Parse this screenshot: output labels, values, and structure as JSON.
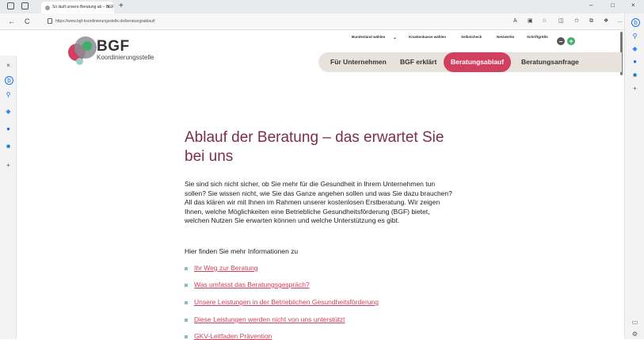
{
  "browser": {
    "tab_title": "So läuft unsere Beratung ab – BGF",
    "tab_close": "×",
    "new_tab": "+",
    "url": "https://www.bgf-koordinierungsstelle.de/beratungsablauf/",
    "minimize": "–",
    "maximize": "□",
    "close": "×",
    "back": "←",
    "reload": "C"
  },
  "site": {
    "brand": "BGF",
    "brand_sub": "Koordinierungsstelle",
    "top_links": [
      "Bundesland wählen",
      "Krankenkasse wählen",
      "Selbstcheck",
      "Netzwerke",
      "Schriftgröße"
    ],
    "dropdown_caret": "⌄",
    "font_minus": "–",
    "font_plus": "+",
    "main_nav": [
      "Für Unternehmen",
      "BGF erklärt",
      "Beratungsablauf",
      "Beratungsanfrage"
    ],
    "active_nav": "Beratungsablauf"
  },
  "content": {
    "heading": "Ablauf der Beratung – das erwartet Sie bei uns",
    "paragraph": "Sie sind sich nicht sicher, ob Sie mehr für die Gesundheit in Ihrem Unternehmen tun sollen? Sie wissen nicht, wie Sie das Ganze angehen sollen und was Sie dazu brauchen? All das klären wir mit Ihnen im Rahmen unserer kostenlosen Erstberatung. Wir zeigen Ihnen, welche Möglichkeiten eine Betriebliche Gesundheitsförderung (BGF) bietet, welchen Nutzen Sie erwarten können und welche Unterstützung es gibt.",
    "more_info": "Hier finden Sie mehr Informationen zu",
    "links": [
      "Ihr Weg zur Beratung",
      "Was umfasst das Beratungsgespräch?",
      "Unsere Leistungen in der Betrieblichen Gesundheitsförderung",
      "Diese Leistungen werden nicht von uns unterstützt",
      "GKV-Leitfaden Prävention"
    ]
  },
  "colors": {
    "accent": "#d2405f",
    "heading": "#7d2d4b",
    "nav_bg": "#e8e2dc",
    "bullet": "#8fb8c8"
  },
  "icons": [
    "back-icon",
    "reload-icon",
    "lock-icon",
    "favorites-icon",
    "bing-icon",
    "search-icon",
    "extensions-icon"
  ]
}
